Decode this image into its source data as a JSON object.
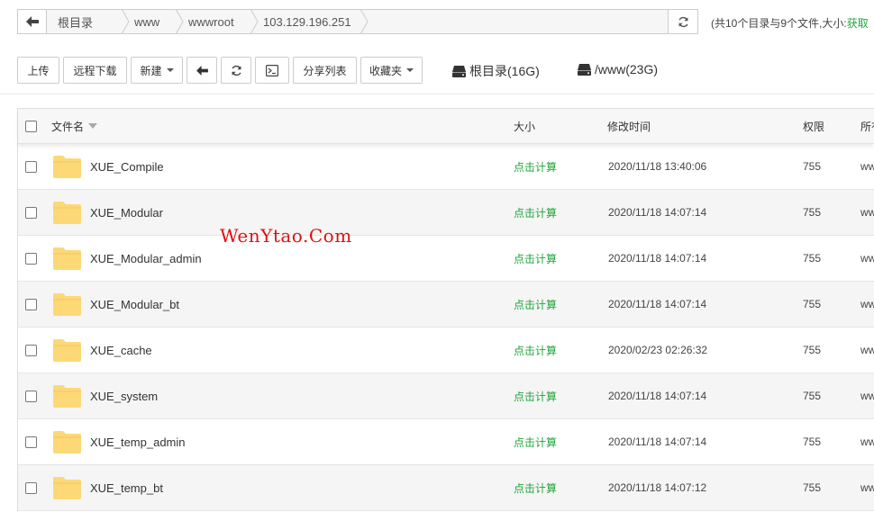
{
  "breadcrumb": {
    "items": [
      "根目录",
      "www",
      "wwwroot",
      "103.129.196.251"
    ]
  },
  "size_info": {
    "text": "(共10个目录与9个文件,大小:",
    "link": "获取"
  },
  "toolbar": {
    "upload": "上传",
    "remote_download": "远程下载",
    "new": "新建",
    "share_list": "分享列表",
    "favorites": "收藏夹"
  },
  "disks": [
    {
      "label": "根目录(16G)",
      "icon": "hdd-icon"
    },
    {
      "label": "/www(23G)",
      "icon": "hdd-icon"
    }
  ],
  "table": {
    "headers": {
      "name": "文件名",
      "size": "大小",
      "mtime": "修改时间",
      "perm": "权限",
      "owner": "所有"
    },
    "rows": [
      {
        "name": "XUE_Compile",
        "size": "点击计算",
        "mtime": "2020/11/18 13:40:06",
        "perm": "755",
        "owner": "ww"
      },
      {
        "name": "XUE_Modular",
        "size": "点击计算",
        "mtime": "2020/11/18 14:07:14",
        "perm": "755",
        "owner": "ww"
      },
      {
        "name": "XUE_Modular_admin",
        "size": "点击计算",
        "mtime": "2020/11/18 14:07:14",
        "perm": "755",
        "owner": "ww"
      },
      {
        "name": "XUE_Modular_bt",
        "size": "点击计算",
        "mtime": "2020/11/18 14:07:14",
        "perm": "755",
        "owner": "ww"
      },
      {
        "name": "XUE_cache",
        "size": "点击计算",
        "mtime": "2020/02/23 02:26:32",
        "perm": "755",
        "owner": "ww"
      },
      {
        "name": "XUE_system",
        "size": "点击计算",
        "mtime": "2020/11/18 14:07:14",
        "perm": "755",
        "owner": "ww"
      },
      {
        "name": "XUE_temp_admin",
        "size": "点击计算",
        "mtime": "2020/11/18 14:07:14",
        "perm": "755",
        "owner": "ww"
      },
      {
        "name": "XUE_temp_bt",
        "size": "点击计算",
        "mtime": "2020/11/18 14:07:12",
        "perm": "755",
        "owner": "ww"
      }
    ]
  },
  "watermark": "WenYtao.Com",
  "colors": {
    "accent_green": "#20a53a",
    "folder_yellow": "#fcd877",
    "watermark_red": "#e01010"
  }
}
